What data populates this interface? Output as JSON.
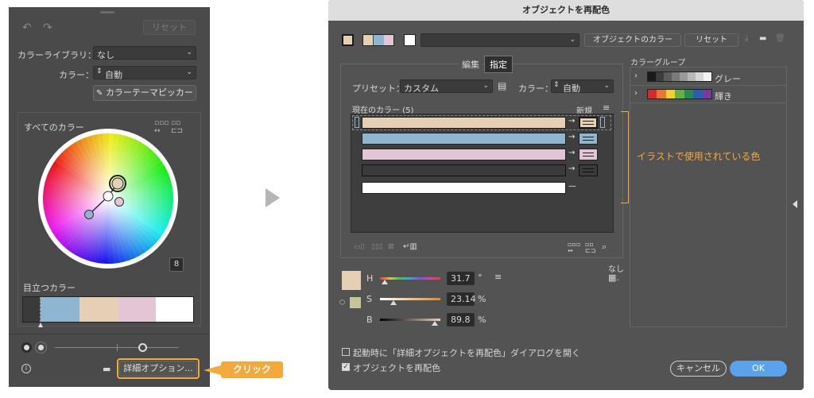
{
  "left_panel": {
    "reset_label": "リセット",
    "library_label": "カラーライブラリ：",
    "library_value": "なし",
    "colors_label": "カラー：",
    "colors_value": "自動",
    "theme_picker_label": "カラーテーマピッカー",
    "all_colors_label": "すべてのカラー",
    "prominent_label": "目立つカラー",
    "prominent_colors": [
      "#3a3a3a",
      "#8fb6d0",
      "#e6d0b5",
      "#e2c6d6",
      "#ffffff"
    ],
    "advanced_button": "詳細オプション...",
    "info_icon": "info-icon",
    "folder_icon": "folder-icon"
  },
  "callout": {
    "label": "クリック"
  },
  "dialog": {
    "title": "オブジェクトを再配色",
    "object_colors_label": "オブジェクトのカラー",
    "reset_label": "リセット",
    "tab_edit": "編集",
    "tab_assign": "指定",
    "preset_label": "プリセット：",
    "preset_value": "カスタム",
    "colors_label": "カラー：",
    "colors_value": "自動",
    "current_colors_label": "現在のカラー (5)",
    "new_label": "新規",
    "current_colors": [
      {
        "color": "#e6d0b5",
        "new": "#e6d0b5"
      },
      {
        "color": "#8fb6d0",
        "new": "#8fb6d0"
      },
      {
        "color": "#e2c6d6",
        "new": "#e2c6d6"
      },
      {
        "color": "#3a3a3a",
        "new": "#3a3a3a"
      },
      {
        "color": "#ffffff",
        "new": ""
      }
    ],
    "annotation": "イラストで使用されている色",
    "color_group_label": "カラーグループ",
    "groups": [
      {
        "name": "グレー",
        "swatches": [
          "#1a1a1a",
          "#3d3d3d",
          "#5c5c5c",
          "#7a7a7a",
          "#999999",
          "#b8b8b8",
          "#d6d6d6",
          "#f2f2f2"
        ]
      },
      {
        "name": "輝き",
        "swatches": [
          "#d62b2b",
          "#e8782a",
          "#f2d12a",
          "#62b046",
          "#2a8a55",
          "#2a5fb0",
          "#7a3aa0"
        ]
      }
    ],
    "h_label": "H",
    "h_value": "31.7",
    "h_unit": "°",
    "s_label": "S",
    "s_value": "23.14",
    "s_unit": "%",
    "b_label": "B",
    "b_value": "89.8",
    "b_unit": "%",
    "none_label": "なし",
    "checkbox_startup": "起動時に「詳細オプジェクトを再配色」ダイアログを開く",
    "checkbox_recolor": "オブジェクトを再配色",
    "cancel_label": "キャンセル",
    "ok_label": "OK"
  }
}
